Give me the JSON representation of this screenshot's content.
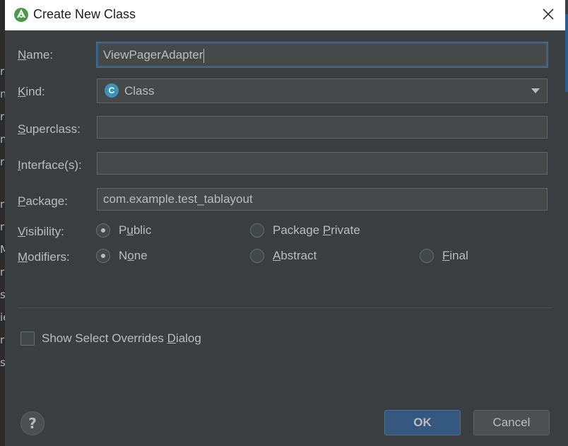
{
  "background": {
    "letters": [
      "r",
      "m",
      "r",
      "n",
      "r",
      "r",
      "r",
      "M",
      "r",
      "s.",
      "ie",
      "r",
      "s"
    ]
  },
  "dialog": {
    "title": "Create New Class",
    "name": {
      "label": "Name:",
      "mnemonic": "N",
      "rest": "ame:",
      "value": "ViewPagerAdapter"
    },
    "kind": {
      "label": "Kind:",
      "mnemonic": "K",
      "rest": "ind:",
      "value": "Class",
      "icon_letter": "C"
    },
    "superclass": {
      "label": "Superclass:",
      "mnemonic": "S",
      "rest": "uperclass:",
      "value": ""
    },
    "interfaces": {
      "label": "Interface(s):",
      "mnemonic": "I",
      "rest": "nterface(s):",
      "value": ""
    },
    "package": {
      "label": "Package:",
      "mnemonic": "P",
      "rest": "ackage:",
      "value": "com.example.test_tablayout"
    },
    "visibility": {
      "label_mnemonic": "V",
      "label_rest": "isibility:",
      "options": [
        {
          "pre": "P",
          "mn": "u",
          "post": "blic",
          "checked": true
        },
        {
          "pre": "Package ",
          "mn": "P",
          "post": "rivate",
          "checked": false
        }
      ]
    },
    "modifiers": {
      "label_mnemonic": "M",
      "label_rest": "odifiers:",
      "options": [
        {
          "pre": "N",
          "mn": "o",
          "post": "ne",
          "checked": true
        },
        {
          "pre": "",
          "mn": "A",
          "post": "bstract",
          "checked": false
        },
        {
          "pre": "",
          "mn": "F",
          "post": "inal",
          "checked": false
        }
      ]
    },
    "show_overrides": {
      "pre": "Show Select Overrides ",
      "mn": "D",
      "post": "ialog",
      "checked": false
    },
    "help_label": "?",
    "ok_label": "OK",
    "cancel_label": "Cancel"
  },
  "colors": {
    "dialog_bg": "#3c3f41",
    "field_bg": "#45494a",
    "focus_border": "#3d6185",
    "ok_bg": "#365880",
    "class_icon": "#3a95b8"
  }
}
